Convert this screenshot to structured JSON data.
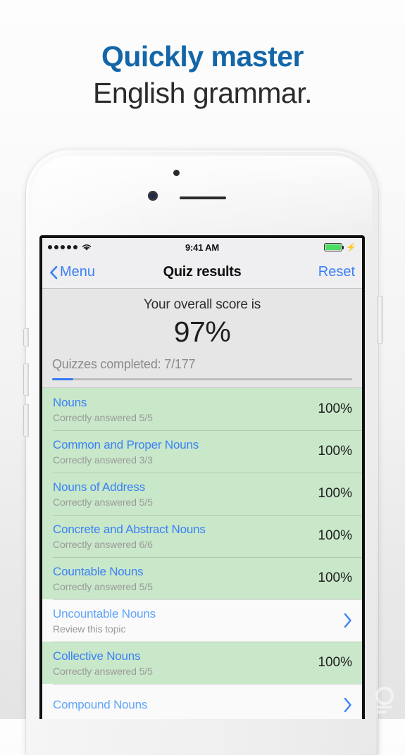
{
  "promo": {
    "headline_line1": "Quickly master",
    "headline_line2": "English grammar."
  },
  "status_bar": {
    "signal_dots": 5,
    "wifi_icon": "wifi-icon",
    "time": "9:41 AM",
    "battery_icon": "battery-full-icon",
    "battery_level_percent": 100,
    "charging_icon": "lightning-bolt-icon"
  },
  "nav_bar": {
    "back_icon": "chevron-left-icon",
    "back_label": "Menu",
    "title": "Quiz results",
    "reset_label": "Reset"
  },
  "score_header": {
    "label": "Your overall score is",
    "value": "97%",
    "quizzes_completed_label": "Quizzes completed: 7/177",
    "progress_percent": 7
  },
  "results": [
    {
      "title": "Nouns",
      "subtitle": "Correctly answered 5/5",
      "score": "100%",
      "state": "done"
    },
    {
      "title": "Common and Proper Nouns",
      "subtitle": "Correctly answered 3/3",
      "score": "100%",
      "state": "done"
    },
    {
      "title": "Nouns of Address",
      "subtitle": "Correctly answered 5/5",
      "score": "100%",
      "state": "done"
    },
    {
      "title": "Concrete and Abstract Nouns",
      "subtitle": "Correctly answered 6/6",
      "score": "100%",
      "state": "done"
    },
    {
      "title": "Countable Nouns",
      "subtitle": "Correctly answered 5/5",
      "score": "100%",
      "state": "done"
    },
    {
      "title": "Uncountable Nouns",
      "subtitle": "Review this topic",
      "score": "",
      "state": "todo"
    },
    {
      "title": "Collective Nouns",
      "subtitle": "Correctly answered 5/5",
      "score": "100%",
      "state": "done"
    },
    {
      "title": "Compound Nouns",
      "subtitle": "",
      "score": "",
      "state": "todo"
    }
  ],
  "colors": {
    "headline_blue": "#1366a8",
    "ios_blue": "#3b82f6",
    "row_done_green": "#c9e7c9",
    "battery_green": "#4ddd62",
    "progress_blue": "#3478f6"
  }
}
